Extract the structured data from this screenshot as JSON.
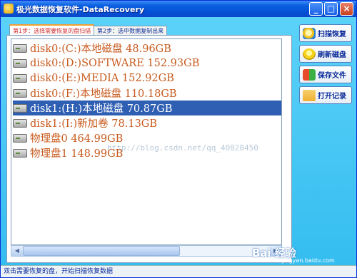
{
  "window": {
    "title": "极光数据恢复软件-DataRecovery",
    "controls": [
      "_",
      "□",
      "×"
    ]
  },
  "tabs": [
    {
      "label": "第1步：选择需要恢复的盘扫描",
      "active": true
    },
    {
      "label": "第2步：选中数据复制出来",
      "active": false
    }
  ],
  "disks": [
    {
      "label": "disk0:(C:)本地磁盘 48.96GB",
      "selected": false
    },
    {
      "label": "disk0:(D:)SOFTWARE 152.93GB",
      "selected": false
    },
    {
      "label": "disk0:(E:)MEDIA 152.92GB",
      "selected": false
    },
    {
      "label": "disk0:(F:)本地磁盘 110.18GB",
      "selected": false
    },
    {
      "label": "disk1:(H:)本地磁盘 70.87GB",
      "selected": true
    },
    {
      "label": "disk1:(I:)新加卷 78.13GB",
      "selected": false
    },
    {
      "label": "物理盘0 464.99GB",
      "selected": false
    },
    {
      "label": "物理盘1 148.99GB",
      "selected": false
    }
  ],
  "watermark": "http://blog.csdn.net/qq_40828450",
  "side_buttons": [
    {
      "label": "扫描恢复",
      "icon": "magnifier-icon",
      "color": "#f0c020"
    },
    {
      "label": "刷新磁盘",
      "icon": "lightbulb-icon",
      "color": "#f7d21a"
    },
    {
      "label": "保存文件",
      "icon": "windows-save-icon",
      "color": "#3a7fd9"
    },
    {
      "label": "打开记录",
      "icon": "folder-icon",
      "color": "#f0b030"
    }
  ],
  "status_text": "双击需要恢复的盘，开始扫描恢复数据",
  "branding": {
    "text": "Bai 经验",
    "sub": "jingyan.baidu.com"
  }
}
